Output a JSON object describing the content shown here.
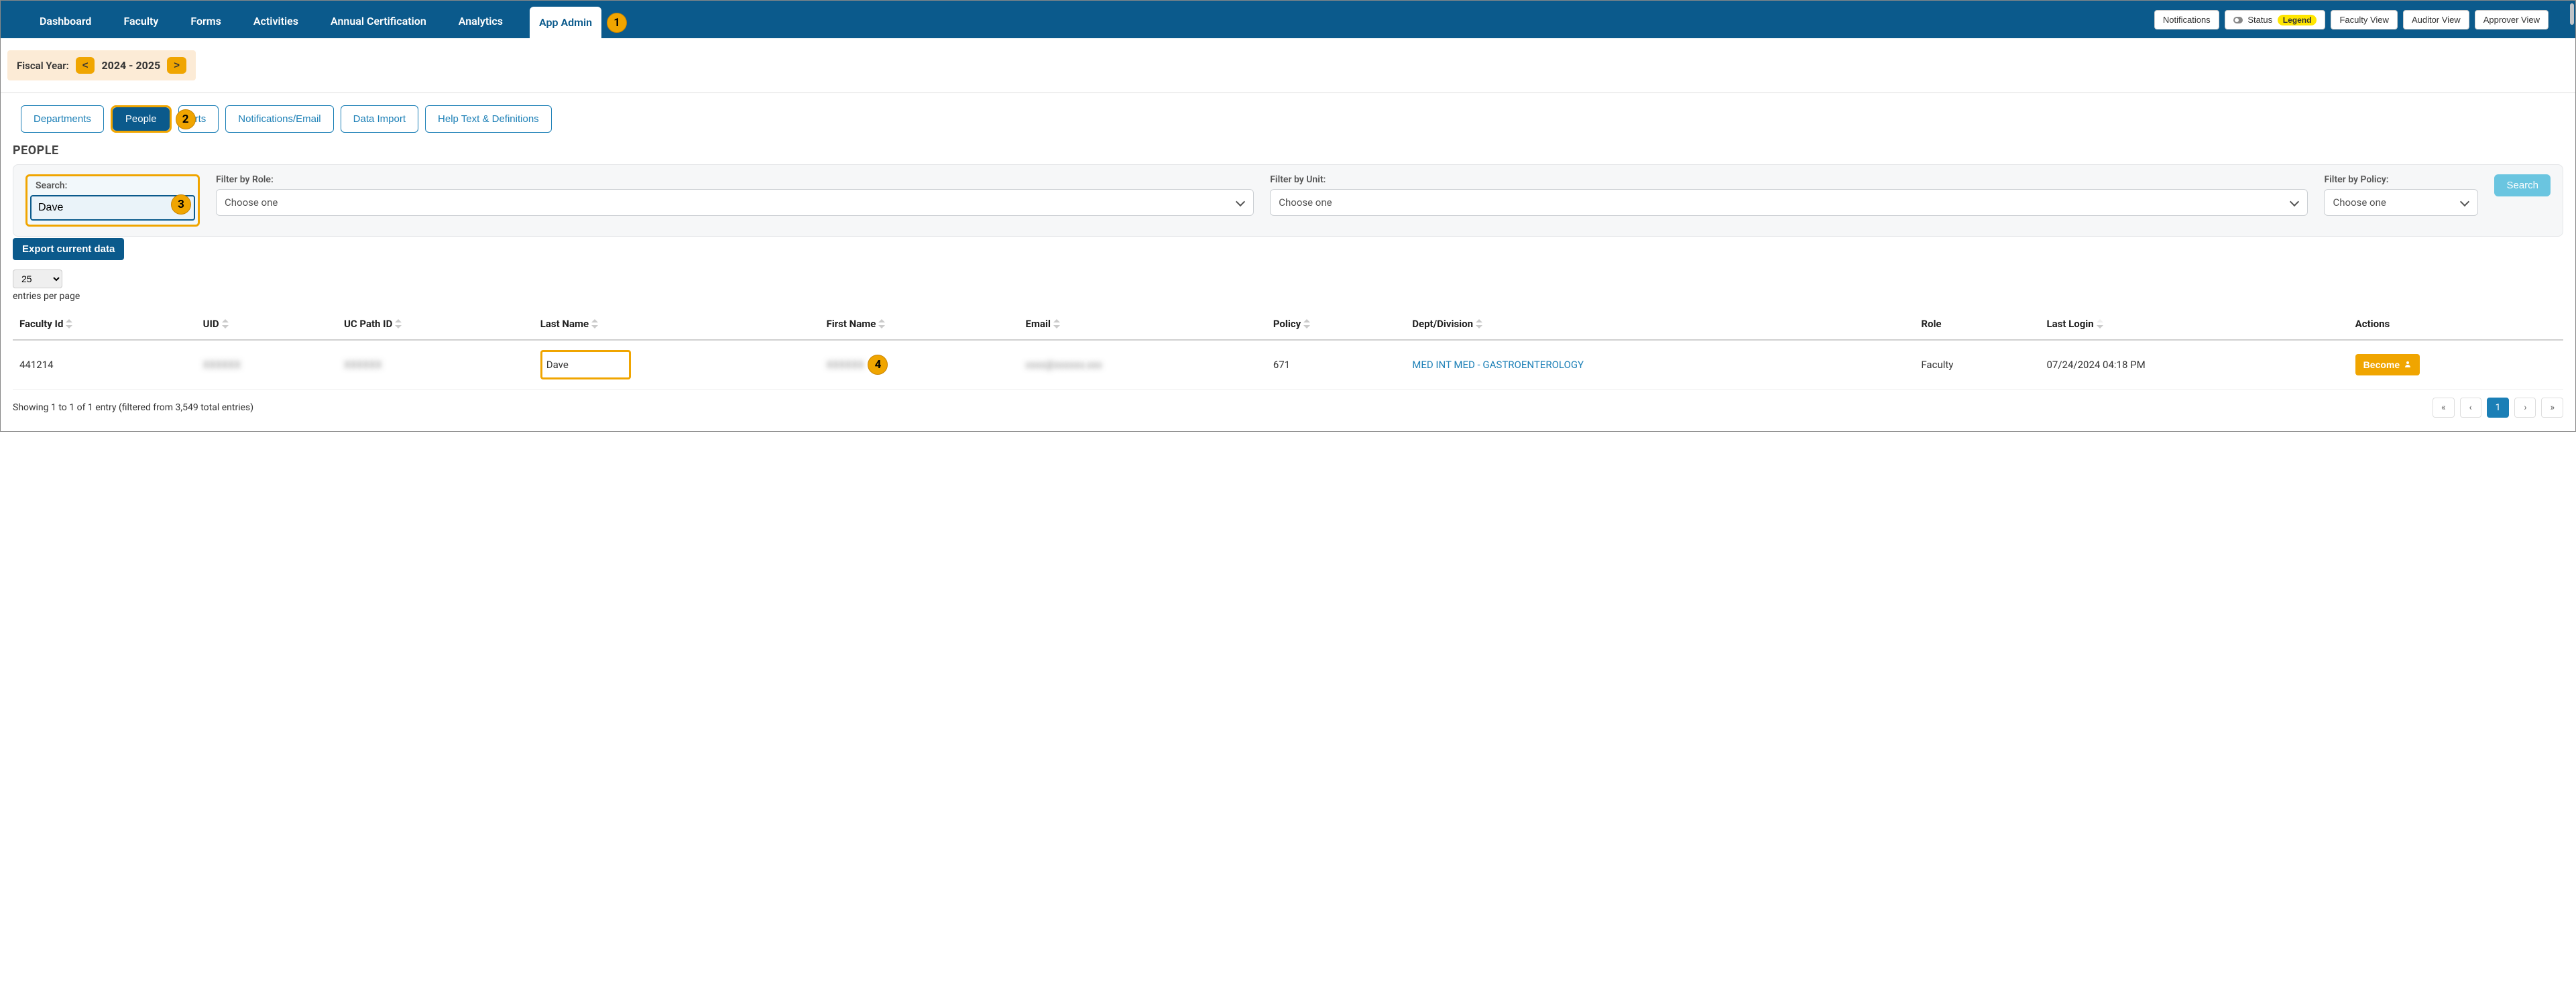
{
  "topnav": {
    "tabs": [
      "Dashboard",
      "Faculty",
      "Forms",
      "Activities",
      "Annual Certification",
      "Analytics",
      "App Admin"
    ],
    "active": "App Admin",
    "buttons": {
      "notifications": "Notifications",
      "status": "Status",
      "legend": "Legend",
      "faculty_view": "Faculty View",
      "auditor_view": "Auditor View",
      "approver_view": "Approver View"
    }
  },
  "fiscal": {
    "label": "Fiscal Year:",
    "prev": "<",
    "year": "2024 - 2025",
    "next": ">"
  },
  "subtabs": {
    "items": [
      "Departments",
      "People",
      "Reports",
      "Notifications/Email",
      "Data Import",
      "Help Text & Definitions"
    ],
    "active": "People",
    "reports_short": "rts"
  },
  "section_title": "PEOPLE",
  "filters": {
    "search_label": "Search:",
    "search_value": "Dave",
    "role_label": "Filter by Role:",
    "unit_label": "Filter by Unit:",
    "policy_label": "Filter by Policy:",
    "choose_one": "Choose one",
    "search_btn": "Search"
  },
  "export_label": "Export current data",
  "perpage": {
    "value": "25",
    "label": "entries per page"
  },
  "columns": {
    "faculty_id": "Faculty Id",
    "uid": "UID",
    "uc_path_id": "UC Path ID",
    "last_name": "Last Name",
    "first_name": "First Name",
    "email": "Email",
    "policy": "Policy",
    "dept": "Dept/Division",
    "role": "Role",
    "last_login": "Last Login",
    "actions": "Actions"
  },
  "rows": [
    {
      "faculty_id": "441214",
      "uid": "",
      "uc_path_id": "",
      "last_name": "Dave",
      "first_name": "",
      "email": "",
      "policy": "671",
      "dept": "MED INT MED - GASTROENTEROLOGY",
      "role": "Faculty",
      "last_login": "07/24/2024 04:18 PM",
      "action": "Become"
    }
  ],
  "footer": {
    "showing": "Showing 1 to 1 of 1 entry (filtered from 3,549 total entries)",
    "pager": {
      "first": "«",
      "prev": "‹",
      "current": "1",
      "next": "›",
      "last": "»"
    }
  },
  "callouts": {
    "c1": "1",
    "c2": "2",
    "c3": "3",
    "c4": "4"
  }
}
